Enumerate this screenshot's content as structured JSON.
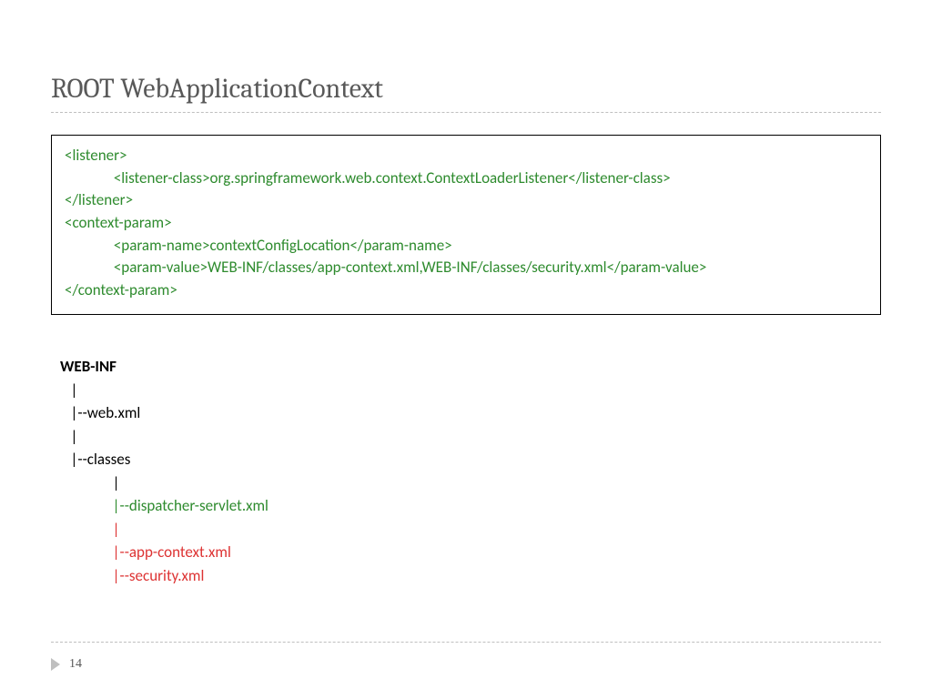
{
  "title": "ROOT WebApplicationContext",
  "code": {
    "l1": "<listener>",
    "l2_tag_open": "<listener-class>",
    "l2_text": "org.springframework.web.context.ContextLoaderListener",
    "l2_tag_close": "</listener-class>",
    "l3": "</listener>",
    "l4": "<context-param>",
    "l5_open": "<param-name>",
    "l5_text": "contextConfigLocation",
    "l5_close": "</param-name>",
    "l6_open": "<param-value>",
    "l6_text": "WEB-INF/classes/app-context.xml,WEB-INF/classes/security.xml",
    "l6_close": "</param-value>",
    "l7": "</context-param>"
  },
  "tree": {
    "root": "WEB-INF",
    "pipe1": "|",
    "webxml": "|--web.xml",
    "pipe2": "|",
    "classes": "|--classes",
    "pipe3": "|",
    "dispatcher": "|--dispatcher-servlet.xml",
    "pipe4": "|",
    "appctx": "|--app-context.xml",
    "security": "|--security.xml"
  },
  "page_number": "14"
}
